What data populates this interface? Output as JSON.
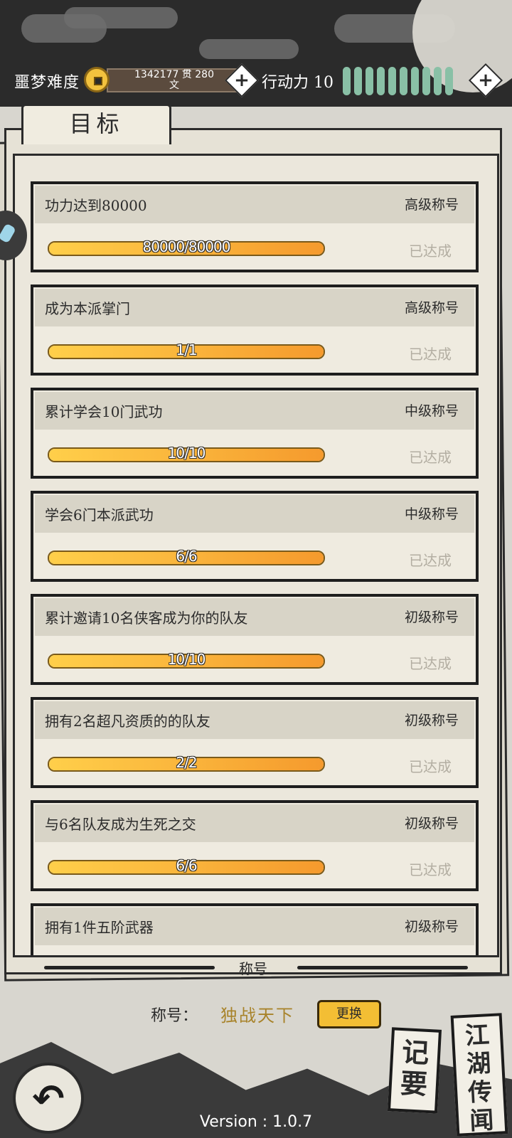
{
  "header": {
    "difficulty": "噩梦难度",
    "money_line1": "1342177  贯    280",
    "money_line2": "文",
    "action_label": "行动力 10",
    "action_points": 10
  },
  "panel": {
    "tab_label": "目标"
  },
  "goals": [
    {
      "title": "功力达到80000",
      "rank": "高级称号",
      "progress_text": "80000/80000",
      "progress": 1.0,
      "status": "已达成"
    },
    {
      "title": "成为本派掌门",
      "rank": "高级称号",
      "progress_text": "1/1",
      "progress": 1.0,
      "status": "已达成"
    },
    {
      "title": "累计学会10门武功",
      "rank": "中级称号",
      "progress_text": "10/10",
      "progress": 1.0,
      "status": "已达成"
    },
    {
      "title": "学会6门本派武功",
      "rank": "中级称号",
      "progress_text": "6/6",
      "progress": 1.0,
      "status": "已达成"
    },
    {
      "title": "累计邀请10名侠客成为你的队友",
      "rank": "初级称号",
      "progress_text": "10/10",
      "progress": 1.0,
      "status": "已达成"
    },
    {
      "title": "拥有2名超凡资质的的队友",
      "rank": "初级称号",
      "progress_text": "2/2",
      "progress": 1.0,
      "status": "已达成"
    },
    {
      "title": "与6名队友成为生死之交",
      "rank": "初级称号",
      "progress_text": "6/6",
      "progress": 1.0,
      "status": "已达成"
    },
    {
      "title": "拥有1件五阶武器",
      "rank": "初级称号",
      "progress_text": "",
      "progress": 0,
      "status": ""
    }
  ],
  "title_section": {
    "heading": "称号",
    "label": "称号：",
    "value": "独战天下",
    "change_button": "更换"
  },
  "footer": {
    "version": "Version : 1.0.7",
    "notes_card": [
      "记",
      "要"
    ],
    "rumors_card": [
      "江",
      "湖",
      "传",
      "闻"
    ]
  },
  "colors": {
    "accent_gold": "#f3be34",
    "action_green": "#89c0a6",
    "title_value": "#a8832a"
  }
}
